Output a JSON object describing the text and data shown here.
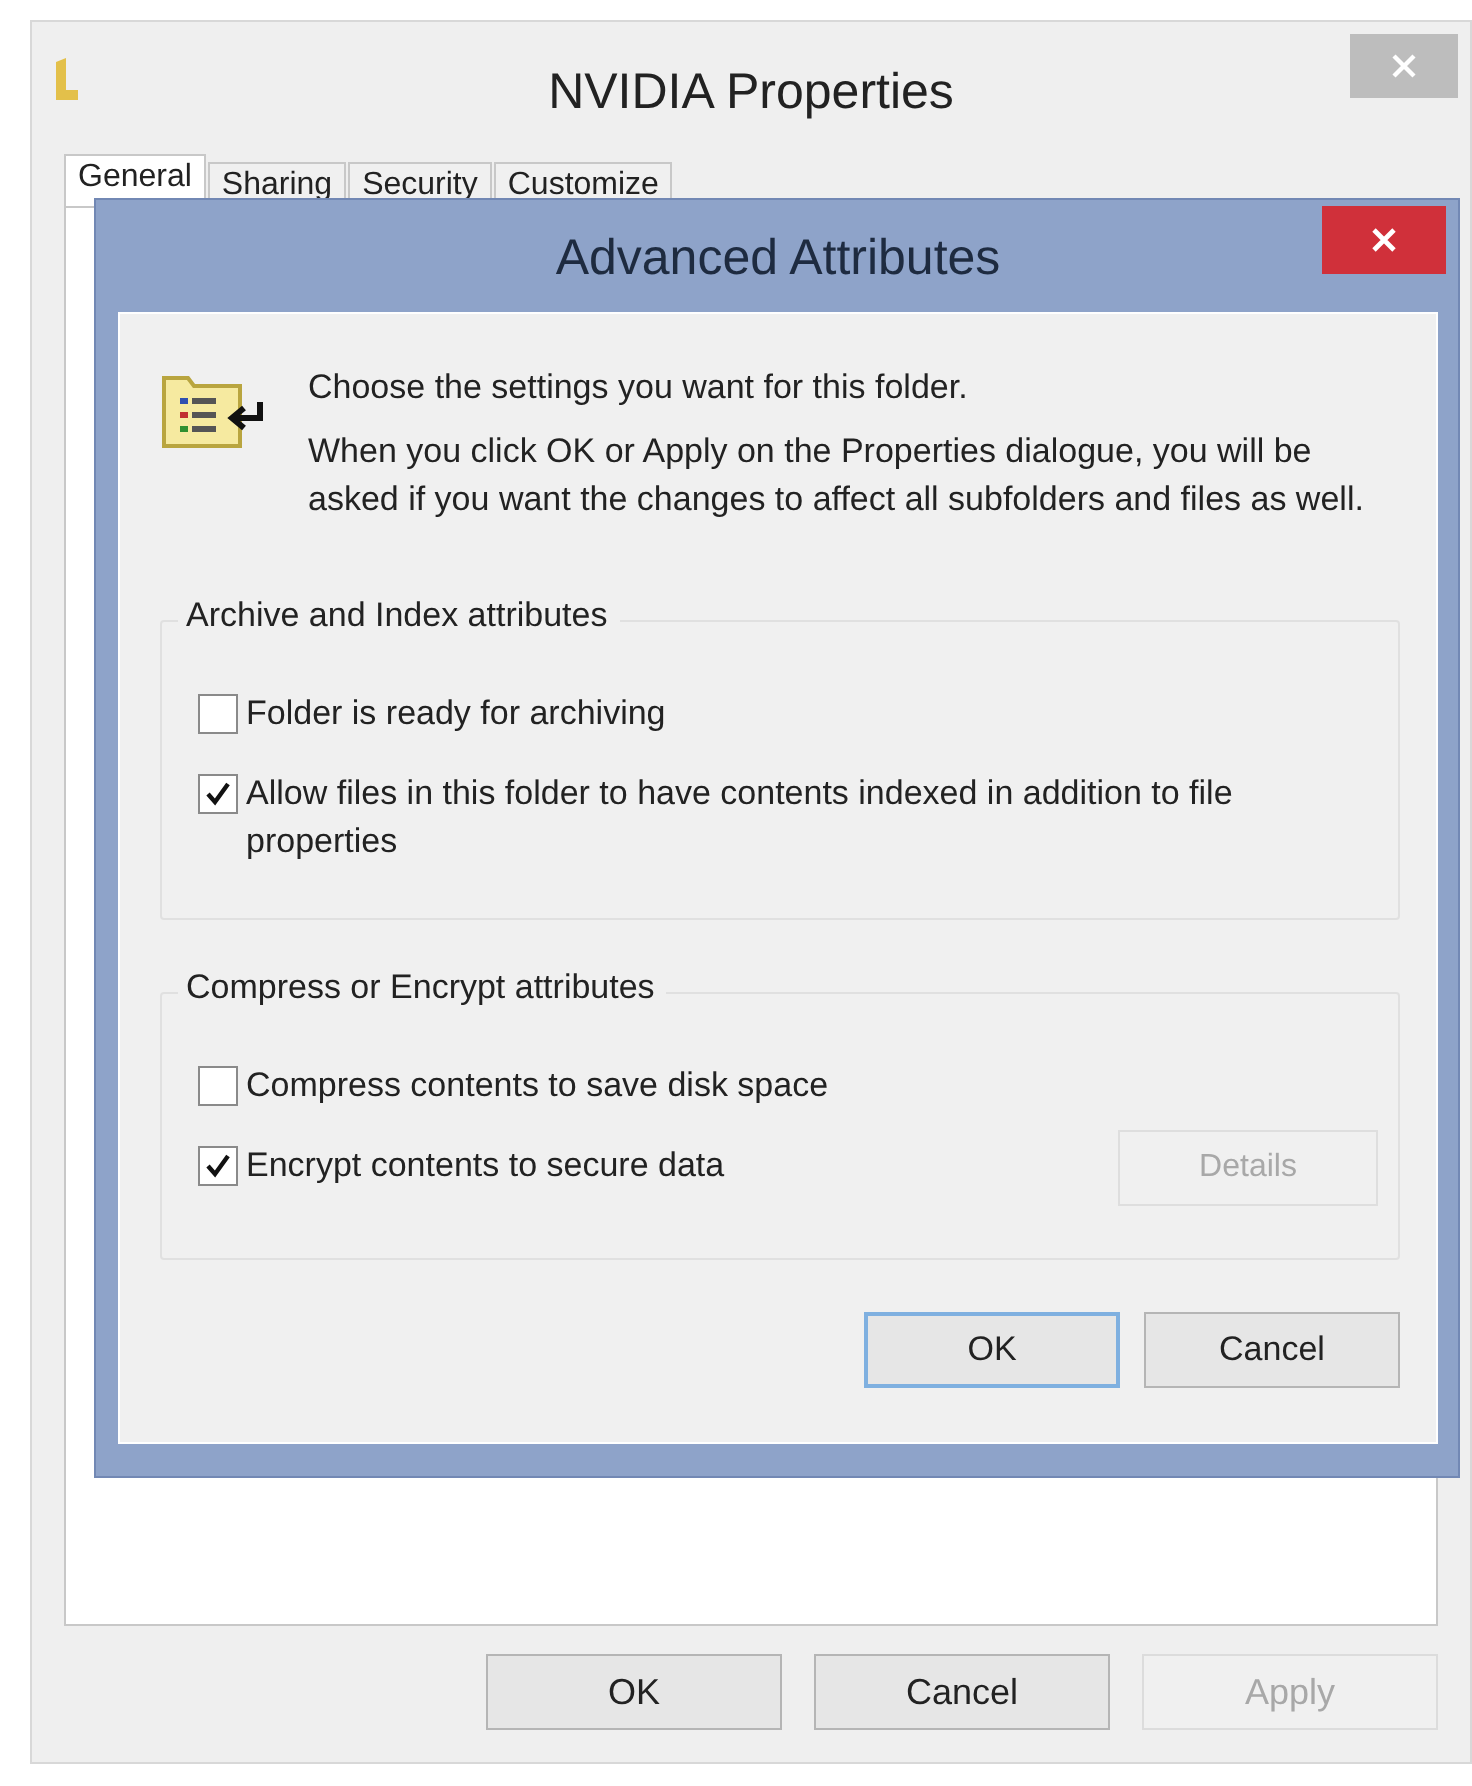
{
  "window": {
    "title": "NVIDIA Properties"
  },
  "tabs": [
    {
      "label": "General",
      "selected": true
    },
    {
      "label": "Sharing",
      "selected": false
    },
    {
      "label": "Security",
      "selected": false
    },
    {
      "label": "Customize",
      "selected": false
    }
  ],
  "buttons": [
    {
      "label": "OK",
      "disabled": false
    },
    {
      "label": "Cancel",
      "disabled": false
    },
    {
      "label": "Apply",
      "disabled": true
    }
  ],
  "dialog": {
    "title": "Advanced Attributes",
    "intro": "Choose the settings you want for this folder.",
    "description": "When you click OK or Apply on the Properties dialogue, you will be asked if you want the changes to affect all subfolders and files as well.",
    "groups": [
      {
        "title": "Archive and Index attributes",
        "options": [
          {
            "label": "Folder is ready for archiving",
            "checked": false
          },
          {
            "label": "Allow files in this folder to have contents indexed in addition to file properties",
            "checked": true
          }
        ]
      },
      {
        "title": "Compress or Encrypt attributes",
        "options": [
          {
            "label": "Compress contents to save disk space",
            "checked": false
          },
          {
            "label": "Encrypt contents to secure data",
            "checked": true
          }
        ],
        "button": {
          "label": "Details",
          "disabled": true
        }
      }
    ],
    "buttons": [
      {
        "label": "OK",
        "default": true
      },
      {
        "label": "Cancel",
        "default": false
      }
    ]
  }
}
